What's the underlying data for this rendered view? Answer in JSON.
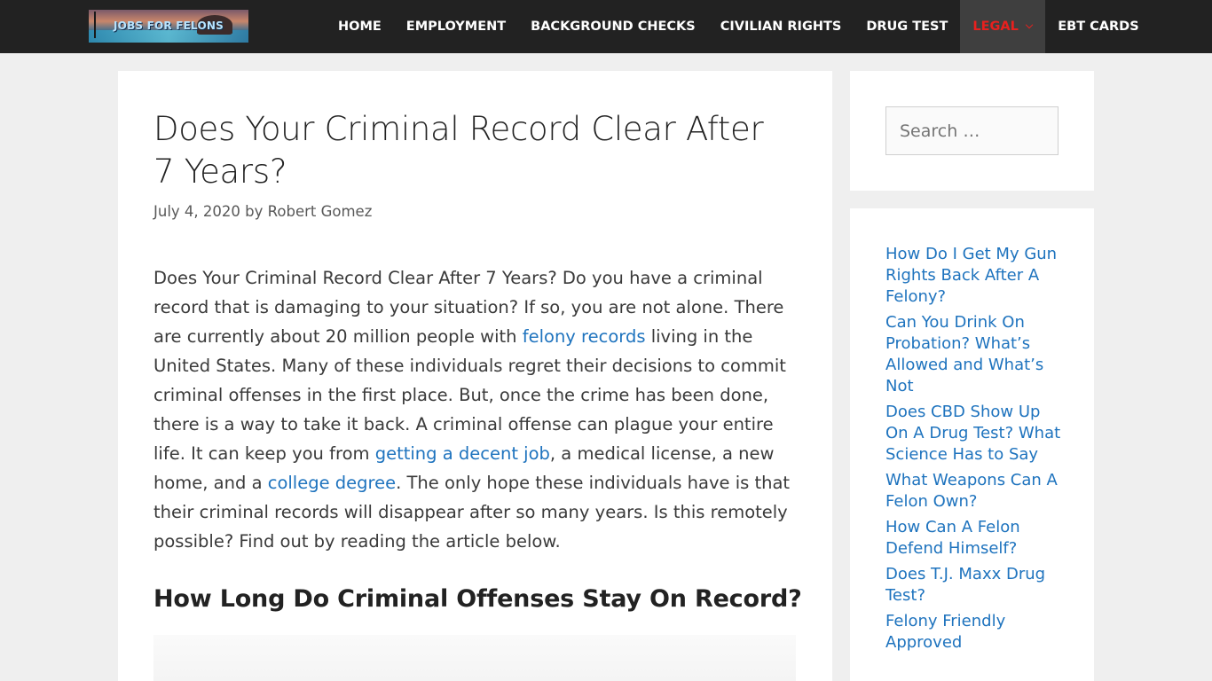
{
  "header": {
    "logo_text": "JOBS FOR FELONS",
    "nav": [
      {
        "label": "HOME"
      },
      {
        "label": "EMPLOYMENT"
      },
      {
        "label": "BACKGROUND CHECKS"
      },
      {
        "label": "CIVILIAN RIGHTS"
      },
      {
        "label": "DRUG TEST"
      },
      {
        "label": "LEGAL",
        "active": true
      },
      {
        "label": "EBT CARDS"
      }
    ],
    "active_color": "#e8201e"
  },
  "article": {
    "title": "Does Your Criminal Record Clear After 7 Years?",
    "date": "July 4, 2020",
    "by": "by",
    "author": "Robert Gomez",
    "para": {
      "t1": "Does Your Criminal Record Clear After 7 Years? Do you have a criminal record that is damaging to your situation? If so, you are not alone. There are currently about 20 million people with ",
      "link1": "felony records",
      "t2": " living in the United States. Many of these individuals regret their decisions to commit criminal offenses in the first place. But, once the crime has been done, there is a way to take it back. A criminal offense can plague your entire life. It can keep you from ",
      "link2": "getting a decent job",
      "t3": ", a medical license, a new home, and a ",
      "link3": "college degree",
      "t4": ". The only hope these individuals have is that their criminal records will disappear after so many years. Is this remotely possible? Find out by reading the article below."
    },
    "subheading": "How Long Do Criminal Offenses Stay On Record?",
    "link_color": "#1e73be"
  },
  "sidebar": {
    "search_placeholder": "Search …",
    "recent_posts": [
      "How Do I Get My Gun Rights Back After A Felony?",
      "Can You Drink On Probation? What’s Allowed and What’s Not",
      "Does CBD Show Up On A Drug Test? What Science Has to Say",
      "What Weapons Can A Felon Own?",
      "How Can A Felon Defend Himself?",
      "Does T.J. Maxx Drug Test?",
      "Felony Friendly Approved"
    ]
  }
}
